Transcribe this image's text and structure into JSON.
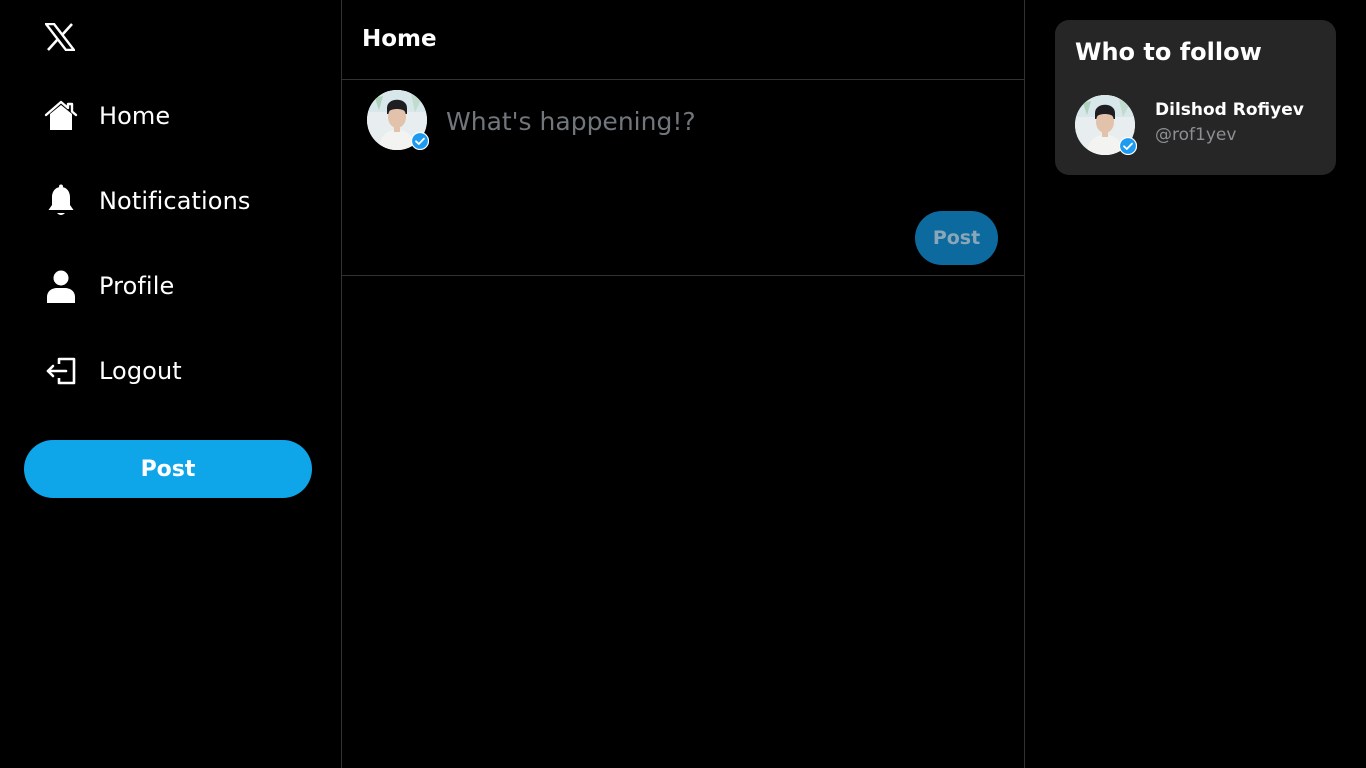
{
  "sidebar": {
    "logo_icon": "x-logo-icon",
    "items": [
      {
        "label": "Home",
        "icon": "home-icon"
      },
      {
        "label": "Notifications",
        "icon": "bell-icon"
      },
      {
        "label": "Profile",
        "icon": "user-icon"
      },
      {
        "label": "Logout",
        "icon": "logout-icon"
      }
    ],
    "post_label": "Post"
  },
  "main": {
    "title": "Home",
    "composer": {
      "placeholder": "What's happening!?",
      "post_label": "Post"
    }
  },
  "who_to_follow": {
    "title": "Who to follow",
    "users": [
      {
        "name": "Dilshod Rofiyev",
        "handle": "@rof1yev",
        "verified": true
      }
    ]
  },
  "colors": {
    "background": "#000000",
    "accent": "#0ea5e9",
    "post_disabled": "#0c6a9e",
    "card": "#262626",
    "border": "#2f3336"
  }
}
